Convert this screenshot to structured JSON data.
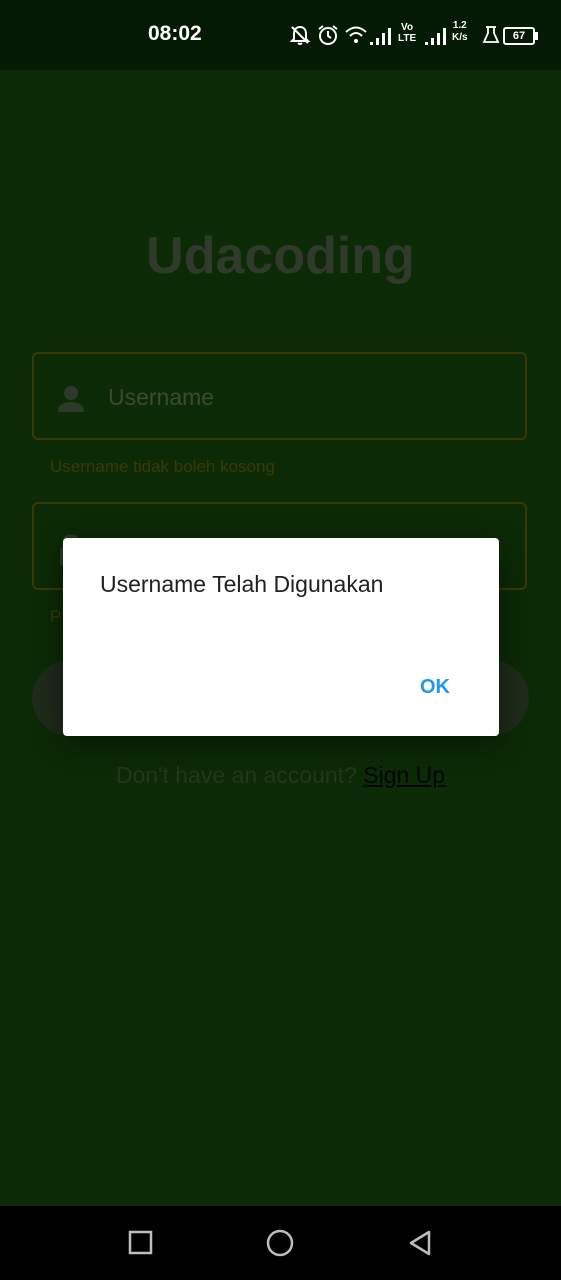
{
  "status_bar": {
    "time": "08:02",
    "volte_top": "Vo",
    "volte_bottom": "LTE",
    "speed_value": "1.2",
    "speed_unit": "K/s",
    "battery": "67",
    "icons": [
      "bell-off-icon",
      "alarm-icon",
      "wifi-icon",
      "signal-icon",
      "volte-badge",
      "signal-icon",
      "data-speed",
      "flask-icon",
      "battery-icon"
    ]
  },
  "app": {
    "title": "Udacoding",
    "username_placeholder": "Username",
    "username_error": "Username tidak boleh kosong",
    "password_placeholder": "",
    "password_error": "P",
    "signup_prompt": "Don't have an account?",
    "signup_link": "Sign Up"
  },
  "dialog": {
    "message": "Username Telah Digunakan",
    "ok_label": "OK"
  },
  "nav_bar": {
    "icons": [
      "recent-apps-icon",
      "home-icon",
      "back-icon"
    ]
  },
  "colors": {
    "background": "#0c2a05",
    "status_bar": "#041a02",
    "dialog_accent": "#2196f3"
  }
}
